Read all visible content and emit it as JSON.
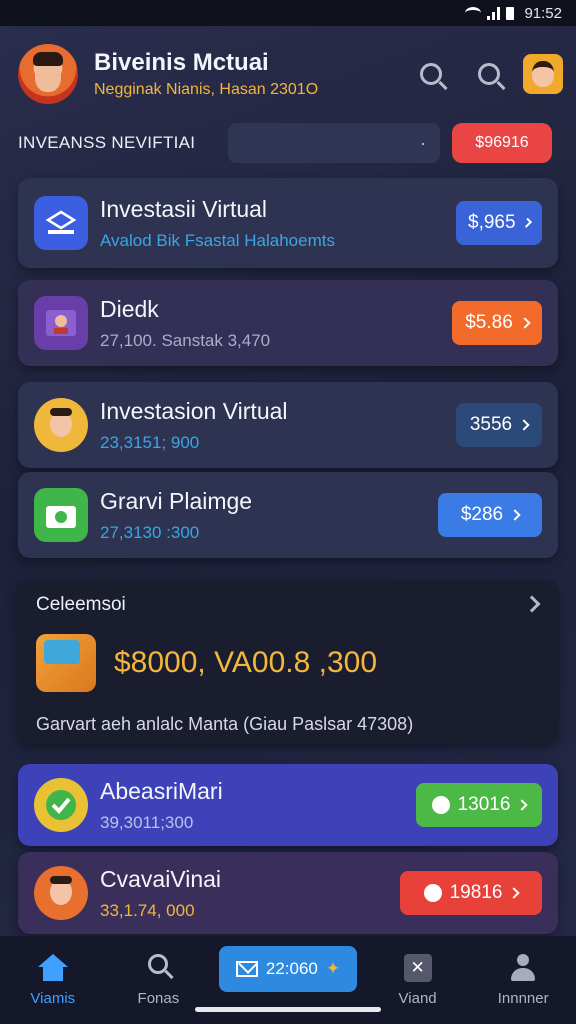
{
  "status_bar": {
    "time": "91:52"
  },
  "header": {
    "title": "Biveinis Mctuai",
    "subtitle": "Negginak Nianis, Hasan 2301O"
  },
  "filter": {
    "label": "INVEANSS NEVIFTIAI",
    "select_value": "",
    "button_label": "$96916"
  },
  "cards": [
    {
      "title": "Investasii Virtual",
      "subtitle": "Avalod Bik Fsastal Halahoemts",
      "action": "$,965",
      "color": "#3a63d8"
    },
    {
      "title": "Diedk",
      "subtitle": "27,100. Sanstak 3,470",
      "action": "$5.86",
      "color": "#f26b2a"
    },
    {
      "title": "Investasion Virtual",
      "subtitle": "23,3151; 900",
      "action": "3556",
      "color": "#2b4a7a"
    },
    {
      "title": "Grarvi Plaimge",
      "subtitle": "27,3130 :300",
      "action": "$286",
      "color": "#3a7be6"
    }
  ],
  "summary": {
    "title": "Celeemsoi",
    "amount": "$8000, VA00.8 ,300",
    "note": "Garvart aeh anlalc Manta (Giau Paslsar 47308)"
  },
  "bottom_cards": [
    {
      "title": "AbeasriMari",
      "subtitle": "39,3011;300",
      "action": "13016",
      "color": "#4cb846"
    },
    {
      "title": "CvavaiVinai",
      "subtitle": "33,1.74, 000",
      "action": "19816",
      "color": "#e8413a"
    }
  ],
  "nav": {
    "items": [
      "Viamis",
      "Fonas",
      "Viand",
      "Innnner"
    ],
    "center_label": "22:060"
  },
  "colors": {
    "accent": "#3fa0ff",
    "gold": "#f4b73a",
    "danger": "#e94545"
  }
}
